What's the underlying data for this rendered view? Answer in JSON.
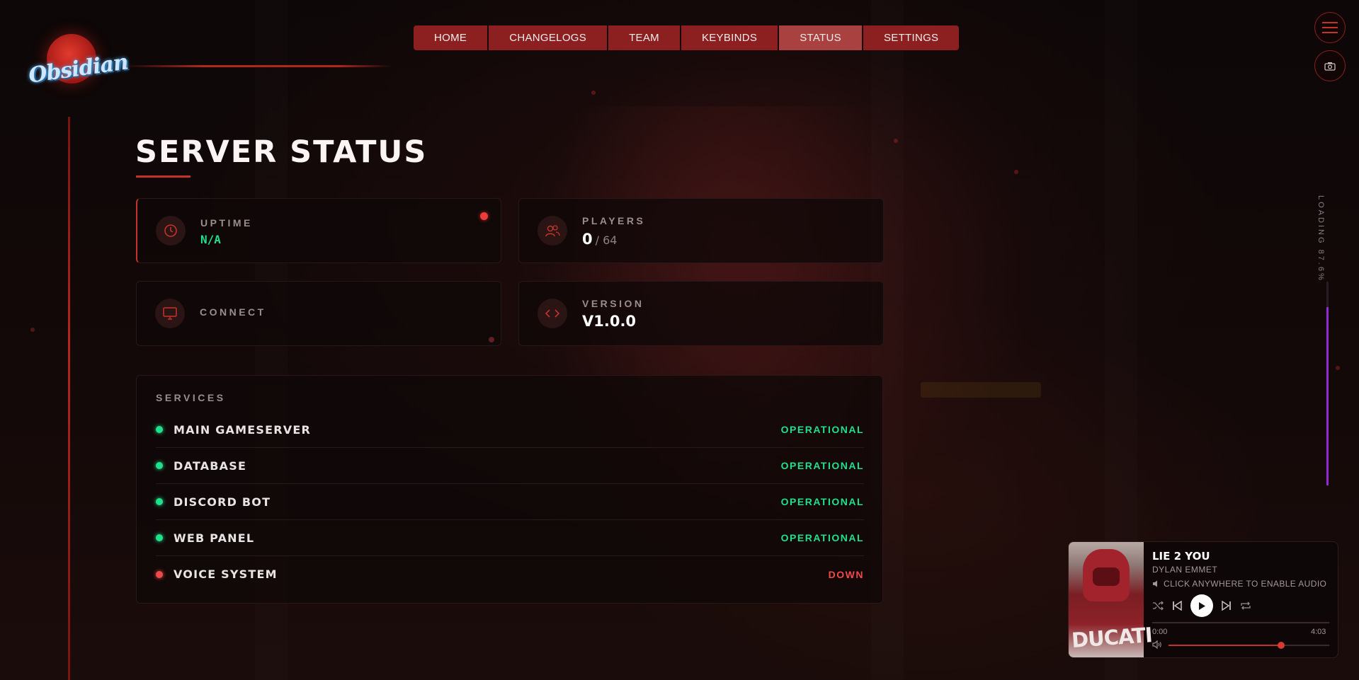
{
  "logo": {
    "text": "Obsidian"
  },
  "nav": {
    "items": [
      "HOME",
      "CHANGELOGS",
      "TEAM",
      "KEYBINDS",
      "STATUS",
      "SETTINGS"
    ],
    "active": "STATUS"
  },
  "header_buttons": {
    "menu_icon": "hamburger-icon",
    "screenshot_icon": "camera-icon"
  },
  "loading": {
    "label": "LOADING 87.6%",
    "progress": 0.876,
    "color": "#8f2ad6"
  },
  "page": {
    "title": "SERVER STATUS"
  },
  "cards": {
    "uptime": {
      "label": "UPTIME",
      "value": "N/A",
      "icon": "clock-icon"
    },
    "players": {
      "label": "PLAYERS",
      "value": "0",
      "max": "/ 64",
      "icon": "users-icon"
    },
    "connect": {
      "label": "CONNECT",
      "icon": "monitor-icon"
    },
    "version": {
      "label": "VERSION",
      "value": "V1.0.0",
      "icon": "code-icon"
    }
  },
  "services": {
    "title": "SERVICES",
    "items": [
      {
        "name": "MAIN GAMESERVER",
        "status": "OPERATIONAL",
        "color": "#20e08c"
      },
      {
        "name": "DATABASE",
        "status": "OPERATIONAL",
        "color": "#20e08c"
      },
      {
        "name": "DISCORD BOT",
        "status": "OPERATIONAL",
        "color": "#20e08c"
      },
      {
        "name": "WEB PANEL",
        "status": "OPERATIONAL",
        "color": "#20e08c"
      },
      {
        "name": "VOICE SYSTEM",
        "status": "DOWN",
        "color": "#ee4a4a"
      }
    ]
  },
  "player": {
    "song": "LIE 2 YOU",
    "artist": "DYLAN EMMET",
    "hint": "CLICK ANYWHERE TO ENABLE AUDIO",
    "cover_text": "DUCATI",
    "current_time": "0:00",
    "total_time": "4:03",
    "progress": 0,
    "volume": 0.7
  },
  "colors": {
    "accent": "#c4332a",
    "nav_bg": "#8c1f1f",
    "nav_active": "#a94141",
    "success": "#20e08c",
    "danger": "#ee3b3b"
  }
}
